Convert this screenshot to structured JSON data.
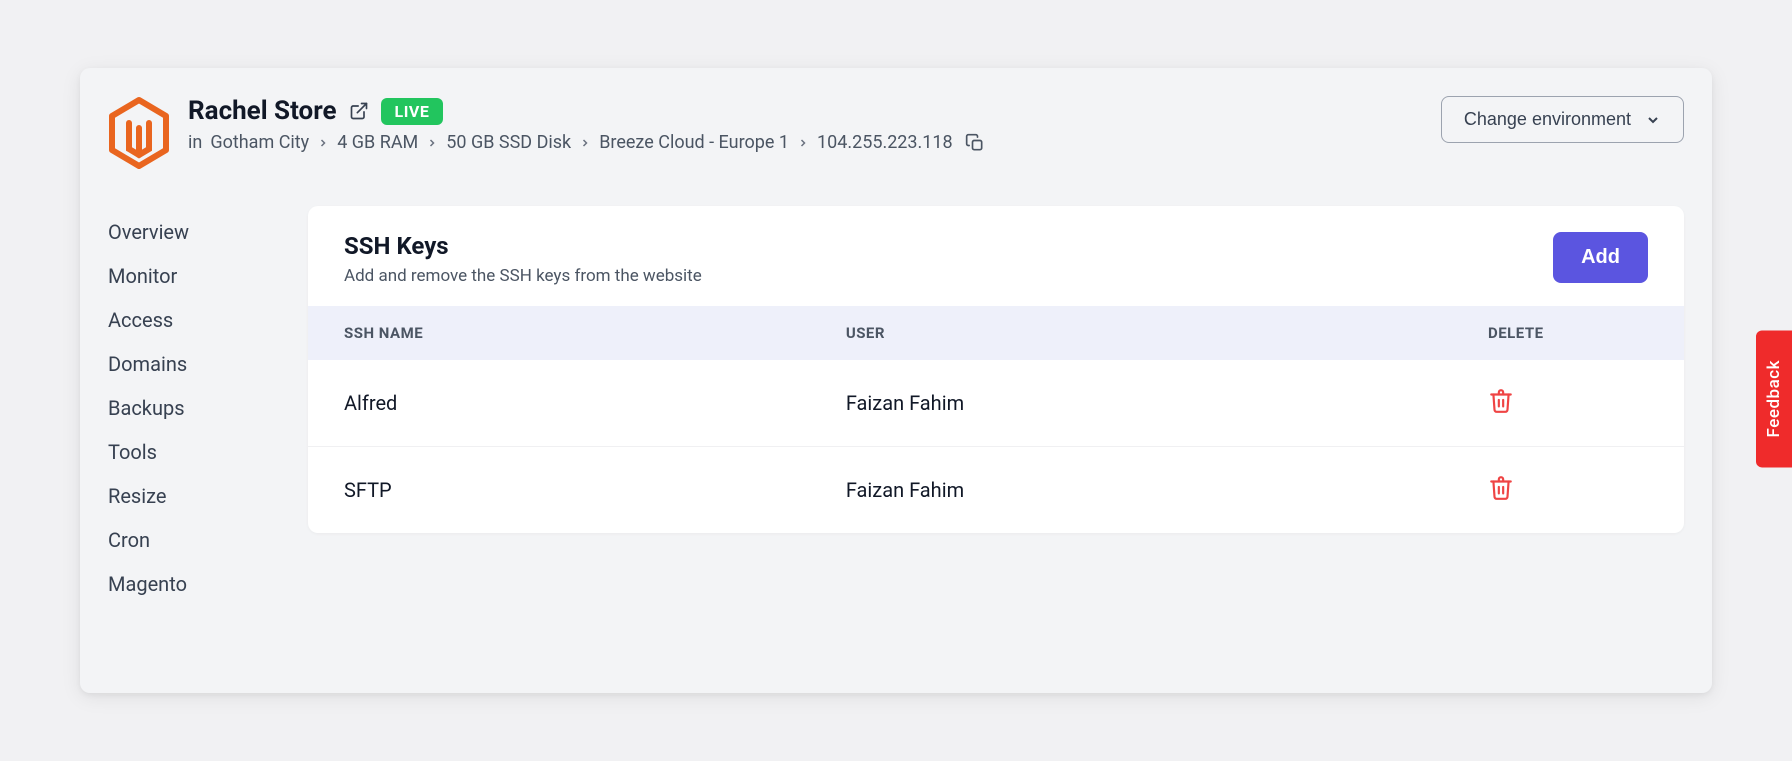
{
  "header": {
    "title": "Rachel Store",
    "badge": "LIVE",
    "breadcrumb_prefix": "in",
    "crumbs": [
      "Gotham City",
      "4 GB RAM",
      "50 GB SSD Disk",
      "Breeze Cloud - Europe 1",
      "104.255.223.118"
    ],
    "env_button": "Change environment"
  },
  "sidebar": {
    "items": [
      "Overview",
      "Monitor",
      "Access",
      "Domains",
      "Backups",
      "Tools",
      "Resize",
      "Cron",
      "Magento"
    ]
  },
  "card": {
    "title": "SSH Keys",
    "subtitle": "Add and remove the SSH keys from the website",
    "add_label": "Add",
    "columns": {
      "name": "SSH NAME",
      "user": "USER",
      "delete": "DELETE"
    },
    "rows": [
      {
        "name": "Alfred",
        "user": "Faizan Fahim"
      },
      {
        "name": "SFTP",
        "user": "Faizan Fahim"
      }
    ]
  },
  "feedback": {
    "label": "Feedback"
  }
}
